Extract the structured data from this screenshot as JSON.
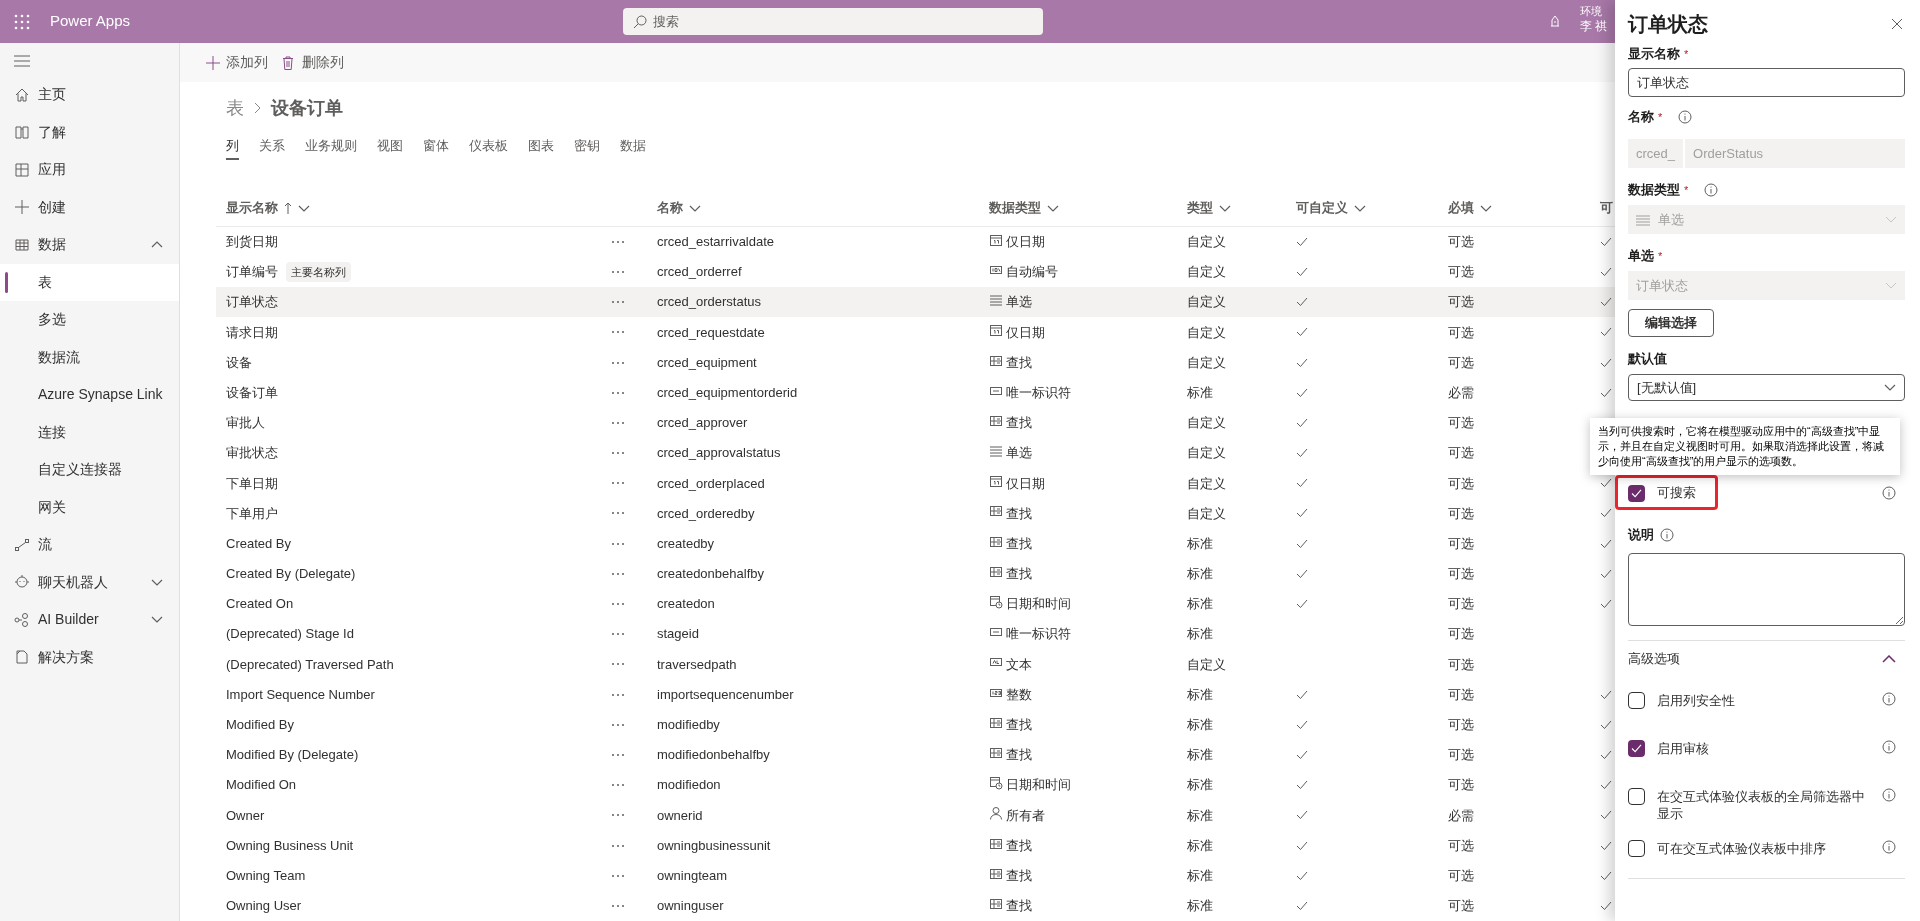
{
  "top_bar": {
    "app_name": "Power Apps",
    "search": {
      "placeholder": "搜索"
    },
    "environment_label": "环境",
    "user_name": "李 祺"
  },
  "sidebar": {
    "items": [
      {
        "label": "主页"
      },
      {
        "label": "了解"
      },
      {
        "label": "应用"
      },
      {
        "label": "创建"
      },
      {
        "label": "数据",
        "expanded": true,
        "children": [
          {
            "label": "表",
            "selected": true
          },
          {
            "label": "多选",
            "selected": false
          },
          {
            "label": "数据流",
            "selected": false
          },
          {
            "label": "Azure Synapse Link",
            "selected": false
          },
          {
            "label": "连接",
            "selected": false
          },
          {
            "label": "自定义连接器",
            "selected": false
          },
          {
            "label": "网关",
            "selected": false
          }
        ]
      },
      {
        "label": "流"
      },
      {
        "label": "聊天机器人",
        "expanded": false
      },
      {
        "label": "AI Builder",
        "expanded": false
      },
      {
        "label": "解决方案"
      }
    ]
  },
  "toolbar": {
    "add_column": "添加列",
    "delete_column": "删除列"
  },
  "breadcrumb": {
    "parent": "表",
    "current": "设备订单"
  },
  "tabs": [
    {
      "label": "列",
      "selected": true
    },
    {
      "label": "关系",
      "selected": false
    },
    {
      "label": "业务规则",
      "selected": false
    },
    {
      "label": "视图",
      "selected": false
    },
    {
      "label": "窗体",
      "selected": false
    },
    {
      "label": "仪表板",
      "selected": false
    },
    {
      "label": "图表",
      "selected": false
    },
    {
      "label": "密钥",
      "selected": false
    },
    {
      "label": "数据",
      "selected": false
    }
  ],
  "table": {
    "columns": [
      {
        "label": "显示名称",
        "sorted_ascending": true
      },
      {
        "label": "名称"
      },
      {
        "label": "数据类型"
      },
      {
        "label": "类型"
      },
      {
        "label": "可自定义"
      },
      {
        "label": "必填"
      },
      {
        "label": "可"
      }
    ],
    "rows": [
      {
        "display_name": "到货日期",
        "name": "crced_estarrivaldate",
        "data_type": {
          "kind": "date",
          "label": "仅日期"
        },
        "type": "自定义",
        "customizable": true,
        "required": "可选",
        "column_7": true,
        "selected": false
      },
      {
        "display_name": "订单编号",
        "badge": "主要名称列",
        "name": "crced_orderref",
        "data_type": {
          "kind": "autonumber",
          "label": "自动编号"
        },
        "type": "自定义",
        "customizable": true,
        "required": "可选",
        "column_7": true,
        "selected": false
      },
      {
        "display_name": "订单状态",
        "name": "crced_orderstatus",
        "data_type": {
          "kind": "choice",
          "label": "单选"
        },
        "type": "自定义",
        "customizable": true,
        "required": "可选",
        "column_7": true,
        "selected": true
      },
      {
        "display_name": "请求日期",
        "name": "crced_requestdate",
        "data_type": {
          "kind": "date",
          "label": "仅日期"
        },
        "type": "自定义",
        "customizable": true,
        "required": "可选",
        "column_7": true,
        "selected": false
      },
      {
        "display_name": "设备",
        "name": "crced_equipment",
        "data_type": {
          "kind": "lookup",
          "label": "查找"
        },
        "type": "自定义",
        "customizable": true,
        "required": "可选",
        "column_7": true,
        "selected": false
      },
      {
        "display_name": "设备订单",
        "name": "crced_equipmentorderid",
        "data_type": {
          "kind": "uniqueid",
          "label": "唯一标识符"
        },
        "type": "标准",
        "customizable": true,
        "required": "必需",
        "column_7": true,
        "selected": false
      },
      {
        "display_name": "审批人",
        "name": "crced_approver",
        "data_type": {
          "kind": "lookup",
          "label": "查找"
        },
        "type": "自定义",
        "customizable": true,
        "required": "可选",
        "selected": false
      },
      {
        "display_name": "审批状态",
        "name": "crced_approvalstatus",
        "data_type": {
          "kind": "choice",
          "label": "单选"
        },
        "type": "自定义",
        "customizable": true,
        "required": "可选",
        "selected": false
      },
      {
        "display_name": "下单日期",
        "name": "crced_orderplaced",
        "data_type": {
          "kind": "date",
          "label": "仅日期"
        },
        "type": "自定义",
        "customizable": true,
        "required": "可选",
        "column_7": true,
        "selected": false
      },
      {
        "display_name": "下单用户",
        "name": "crced_orderedby",
        "data_type": {
          "kind": "lookup",
          "label": "查找"
        },
        "type": "自定义",
        "customizable": true,
        "required": "可选",
        "column_7": true,
        "selected": false
      },
      {
        "display_name": "Created By",
        "name": "createdby",
        "data_type": {
          "kind": "lookup",
          "label": "查找"
        },
        "type": "标准",
        "customizable": true,
        "required": "可选",
        "column_7": true,
        "selected": false
      },
      {
        "display_name": "Created By (Delegate)",
        "name": "createdonbehalfby",
        "data_type": {
          "kind": "lookup",
          "label": "查找"
        },
        "type": "标准",
        "customizable": true,
        "required": "可选",
        "column_7": true,
        "selected": false
      },
      {
        "display_name": "Created On",
        "name": "createdon",
        "data_type": {
          "kind": "datetime",
          "label": "日期和时间"
        },
        "type": "标准",
        "customizable": true,
        "required": "可选",
        "column_7": true,
        "selected": false
      },
      {
        "display_name": "(Deprecated) Stage Id",
        "name": "stageid",
        "data_type": {
          "kind": "uniqueid",
          "label": "唯一标识符"
        },
        "type": "标准",
        "customizable": false,
        "required": "可选",
        "column_7": false,
        "selected": false
      },
      {
        "display_name": "(Deprecated) Traversed Path",
        "name": "traversedpath",
        "data_type": {
          "kind": "text",
          "label": "文本"
        },
        "type": "自定义",
        "customizable": false,
        "required": "可选",
        "column_7": false,
        "selected": false
      },
      {
        "display_name": "Import Sequence Number",
        "name": "importsequencenumber",
        "data_type": {
          "kind": "number",
          "label": "整数"
        },
        "type": "标准",
        "customizable": true,
        "required": "可选",
        "column_7": true,
        "selected": false
      },
      {
        "display_name": "Modified By",
        "name": "modifiedby",
        "data_type": {
          "kind": "lookup",
          "label": "查找"
        },
        "type": "标准",
        "customizable": true,
        "required": "可选",
        "column_7": true,
        "selected": false
      },
      {
        "display_name": "Modified By (Delegate)",
        "name": "modifiedonbehalfby",
        "data_type": {
          "kind": "lookup",
          "label": "查找"
        },
        "type": "标准",
        "customizable": true,
        "required": "可选",
        "column_7": true,
        "selected": false
      },
      {
        "display_name": "Modified On",
        "name": "modifiedon",
        "data_type": {
          "kind": "datetime",
          "label": "日期和时间"
        },
        "type": "标准",
        "customizable": true,
        "required": "可选",
        "column_7": true,
        "selected": false
      },
      {
        "display_name": "Owner",
        "name": "ownerid",
        "data_type": {
          "kind": "owner",
          "label": "所有者"
        },
        "type": "标准",
        "customizable": true,
        "required": "必需",
        "column_7": true,
        "selected": false
      },
      {
        "display_name": "Owning Business Unit",
        "name": "owningbusinessunit",
        "data_type": {
          "kind": "lookup",
          "label": "查找"
        },
        "type": "标准",
        "customizable": true,
        "required": "可选",
        "column_7": true,
        "selected": false
      },
      {
        "display_name": "Owning Team",
        "name": "owningteam",
        "data_type": {
          "kind": "lookup",
          "label": "查找"
        },
        "type": "标准",
        "customizable": true,
        "required": "可选",
        "column_7": true,
        "selected": false
      },
      {
        "display_name": "Owning User",
        "name": "owninguser",
        "data_type": {
          "kind": "lookup",
          "label": "查找"
        },
        "type": "标准",
        "customizable": true,
        "required": "可选",
        "column_7": true,
        "selected": false
      }
    ]
  },
  "panel": {
    "title": "订单状态",
    "display_name": {
      "label": "显示名称",
      "required_mark": "*",
      "value": "订单状态"
    },
    "name": {
      "label": "名称",
      "required_mark": "*",
      "prefix": "crced_",
      "value": "OrderStatus"
    },
    "data_type": {
      "label": "数据类型",
      "required_mark": "*",
      "value": "单选"
    },
    "choice": {
      "label": "单选",
      "required_mark": "*",
      "value": "订单状态"
    },
    "edit_choices_button": "编辑选择",
    "default_value": {
      "label": "默认值",
      "value": "[无默认值]"
    },
    "tooltip": "当列可供搜索时，它将在模型驱动应用中的“高级查找”中显示，并且在自定义视图时可用。如果取消选择此设置，将减少向使用“高级查找”的用户显示的选项数。",
    "searchable": {
      "label": "可搜索",
      "checked": true,
      "highlighted": true
    },
    "description": {
      "label": "说明"
    },
    "advanced": {
      "label": "高级选项",
      "expanded": true,
      "options": [
        {
          "label": "启用列安全性",
          "checked": false
        },
        {
          "label": "启用审核",
          "checked": true
        },
        {
          "label": "在交互式体验仪表板的全局筛选器中显示",
          "checked": false
        },
        {
          "label": "可在交互式体验仪表板中排序",
          "checked": false
        }
      ]
    }
  }
}
